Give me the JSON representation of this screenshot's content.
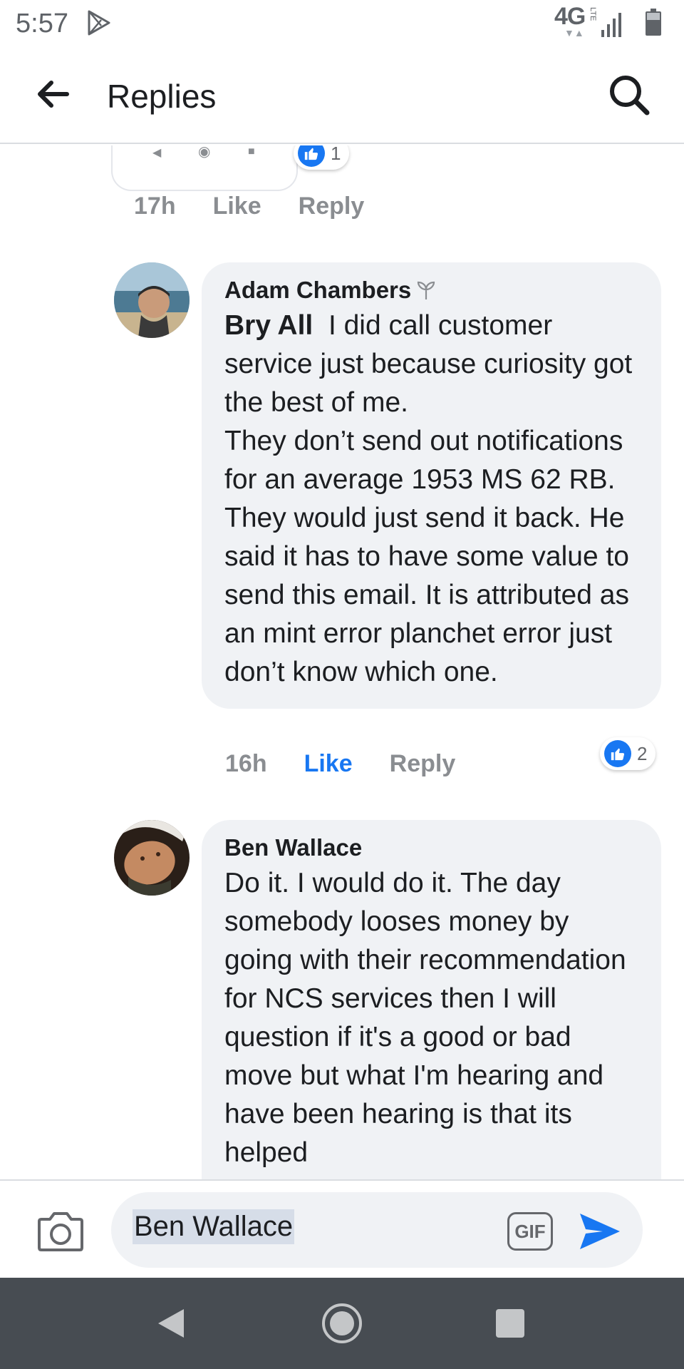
{
  "status_bar": {
    "time": "5:57",
    "network": "4G",
    "network_sub": "LTE",
    "network_arrows": "▼▲",
    "icons": [
      "play-store-icon",
      "signal-icon",
      "battery-icon"
    ]
  },
  "app_bar": {
    "title": "Replies",
    "icons": [
      "back-arrow-icon",
      "search-icon"
    ]
  },
  "previous_comment": {
    "reaction_count": "1",
    "time": "17h",
    "like_label": "Like",
    "reply_label": "Reply"
  },
  "comments": [
    {
      "author": "Adam Chambers",
      "mention": "Bry All",
      "text": "I did call customer service just because curiosity got the best of me.\nThey don’t send out notifications for an average 1953 MS 62 RB. They would just send it back. He said it has to have some value to send this email. It is attributed as an mint error planchet error just don’t know which one.",
      "time": "16h",
      "like_label": "Like",
      "reply_label": "Reply",
      "reaction_count": "2",
      "liked": true
    },
    {
      "author": "Ben Wallace",
      "text": "Do it. I would do it. The day somebody looses money by going with their recommendation for NCS services then I will question if it's a good or bad move but what I'm hearing and have been hearing is that its helped"
    }
  ],
  "composer": {
    "value": "Ben Wallace",
    "gif_label": "GIF",
    "icons": [
      "camera-icon",
      "gif-icon",
      "send-icon"
    ]
  },
  "colors": {
    "accent": "#1877f2",
    "bubble": "#f0f2f5",
    "muted": "#8a8d91",
    "nav_bar": "#474c52"
  }
}
